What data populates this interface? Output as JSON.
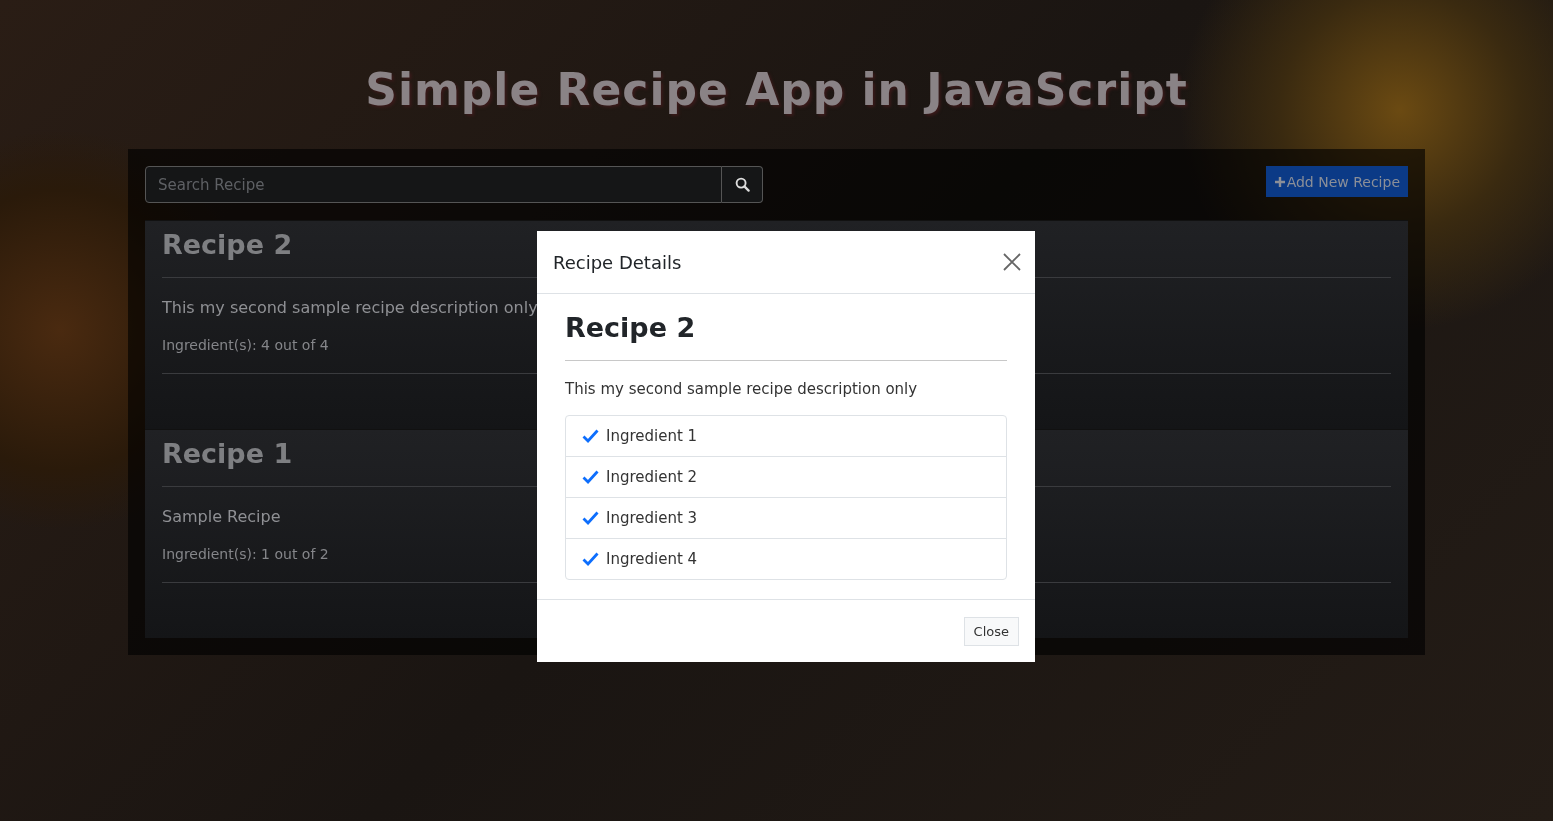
{
  "page_title": "Simple Recipe App in JavaScript",
  "search": {
    "placeholder": "Search Recipe"
  },
  "add_button": "Add New Recipe",
  "recipes": [
    {
      "title": "Recipe 2",
      "description": "This my second sample recipe description only",
      "ingredients_summary": "Ingredient(s): 4 out of 4"
    },
    {
      "title": "Recipe 1",
      "description": "Sample Recipe",
      "ingredients_summary": "Ingredient(s): 1 out of 2"
    }
  ],
  "modal": {
    "title": "Recipe Details",
    "recipe_title": "Recipe 2",
    "description": "This my second sample recipe description only",
    "ingredients": [
      {
        "name": "Ingredient 1",
        "checked": true
      },
      {
        "name": "Ingredient 2",
        "checked": true
      },
      {
        "name": "Ingredient 3",
        "checked": true
      },
      {
        "name": "Ingredient 4",
        "checked": true
      }
    ],
    "close_button": "Close"
  }
}
